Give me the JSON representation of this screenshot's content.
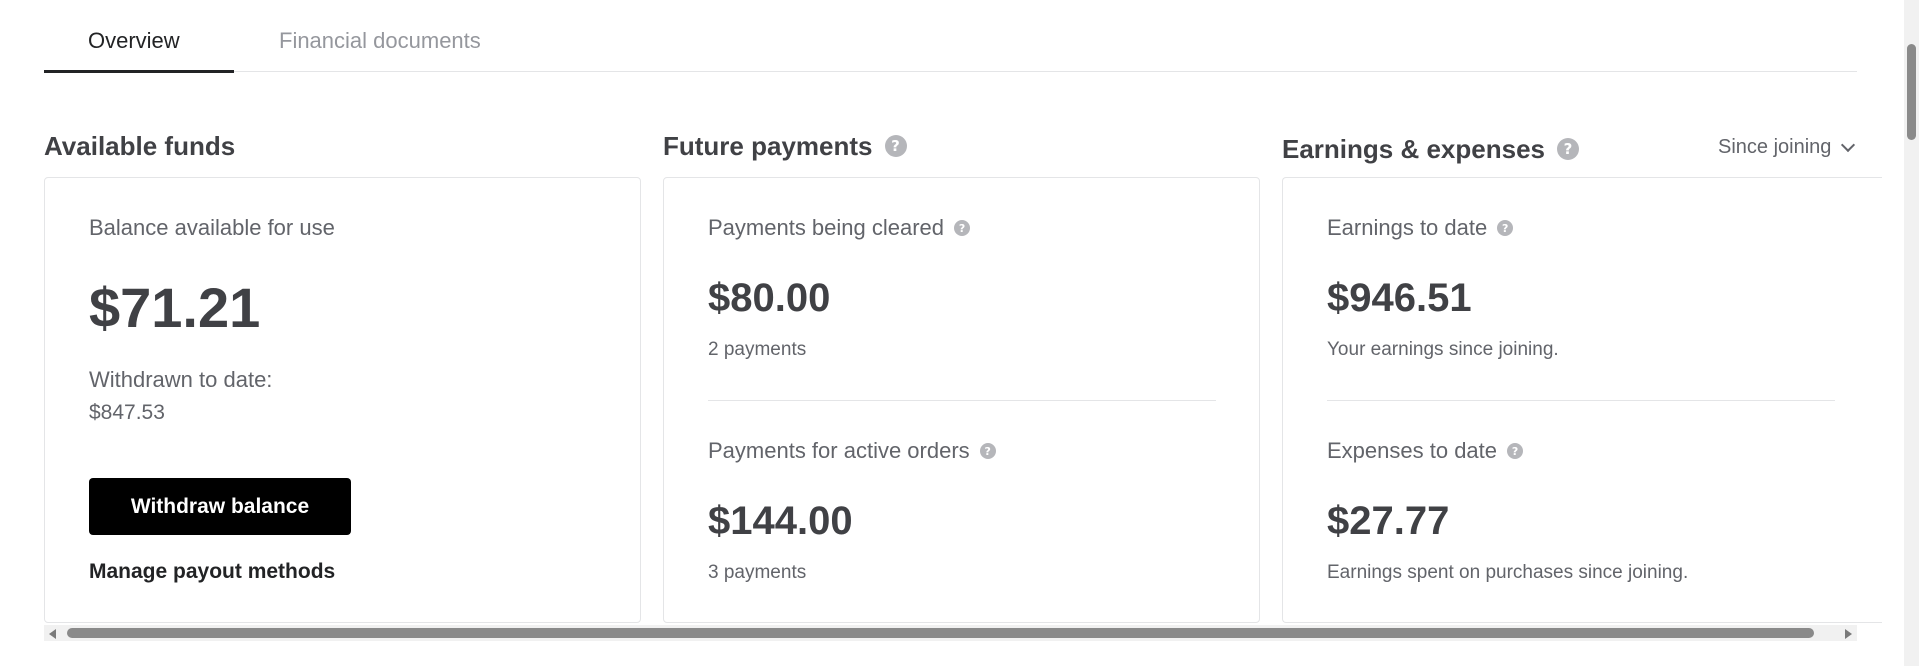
{
  "tabs": [
    {
      "label": "Overview",
      "active": true
    },
    {
      "label": "Financial documents",
      "active": false
    }
  ],
  "sections": {
    "available_funds": {
      "title": "Available funds",
      "balance_label": "Balance available for use",
      "balance_value": "$71.21",
      "withdrawn_label": "Withdrawn to date:",
      "withdrawn_value": "$847.53",
      "withdraw_button": "Withdraw balance",
      "payout_link": "Manage payout methods"
    },
    "future_payments": {
      "title": "Future payments",
      "cleared_label": "Payments being cleared",
      "cleared_value": "$80.00",
      "cleared_sub": "2 payments",
      "active_label": "Payments for active orders",
      "active_value": "$144.00",
      "active_sub": "3 payments"
    },
    "earnings_expenses": {
      "title": "Earnings & expenses",
      "period_select": "Since joining",
      "earnings_label": "Earnings to date",
      "earnings_value": "$946.51",
      "earnings_sub": "Your earnings since joining.",
      "expenses_label": "Expenses to date",
      "expenses_value": "$27.77",
      "expenses_sub": "Earnings spent on purchases since joining."
    }
  },
  "icons": {
    "help": "?"
  },
  "colors": {
    "primary_text": "#404145",
    "secondary_text": "#62646a",
    "muted_tab": "#95979d",
    "button_bg": "#000000",
    "border": "#e4e5e7"
  }
}
